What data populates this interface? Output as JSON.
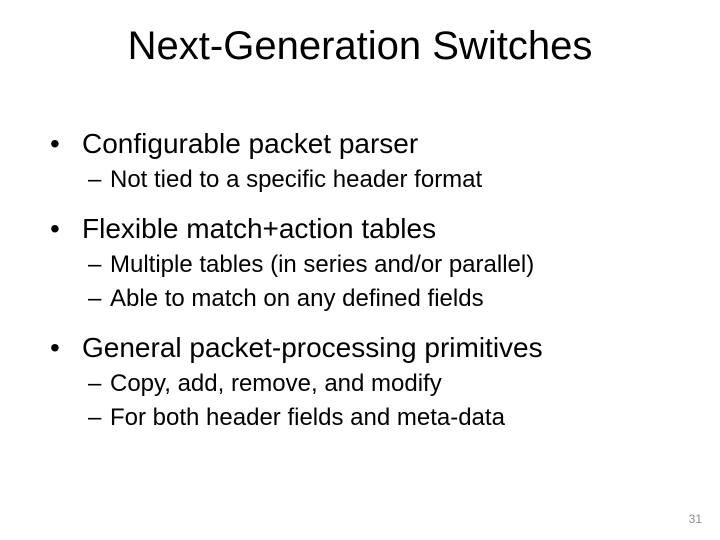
{
  "title": "Next-Generation Switches",
  "groups": [
    {
      "heading": "Configurable packet parser",
      "subs": [
        "Not tied to a specific header format"
      ]
    },
    {
      "heading": "Flexible match+action tables",
      "subs": [
        "Multiple tables (in series and/or parallel)",
        "Able to match on any defined fields"
      ]
    },
    {
      "heading": "General packet-processing primitives",
      "subs": [
        "Copy, add, remove, and modify",
        "For both header fields and meta-data"
      ]
    }
  ],
  "page_number": "31",
  "bullet_char": "•",
  "dash_char": "–"
}
